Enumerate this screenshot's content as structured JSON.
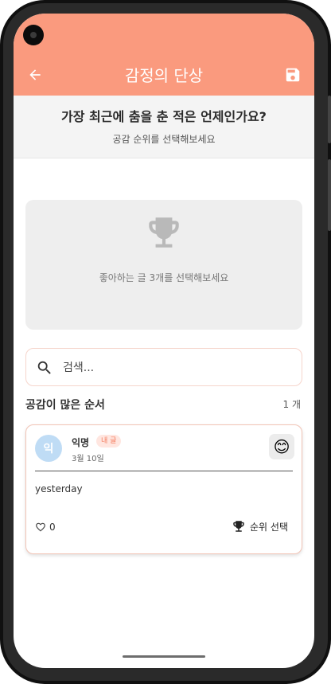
{
  "app_bar": {
    "title": "감정의 단상",
    "back_icon": "arrow-left-icon",
    "save_icon": "save-icon",
    "color": "#fa9a7e"
  },
  "question": {
    "text": "가장 최근에 춤을 춘 적은 언제인가요?",
    "subtitle": "공감 순위를 선택해보세요"
  },
  "ranking": {
    "icon": "trophy-icon",
    "hint": "좋아하는 글 3개를 선택해보세요"
  },
  "search": {
    "placeholder": "검색...",
    "value": ""
  },
  "list": {
    "title": "공감이 많은 순서",
    "count": "1 개"
  },
  "posts": [
    {
      "avatar": "익",
      "author": "익명",
      "badge": "내 글",
      "date": "3월 10일",
      "emotion": "😊",
      "content": "yesterday",
      "likes": "0",
      "rank_label": "순위 선택"
    }
  ],
  "colors": {
    "accent": "#fa9a7e",
    "avatar": "#bfdcf5",
    "badge_bg": "#ffe6e0",
    "badge_text": "#f47c5e"
  }
}
